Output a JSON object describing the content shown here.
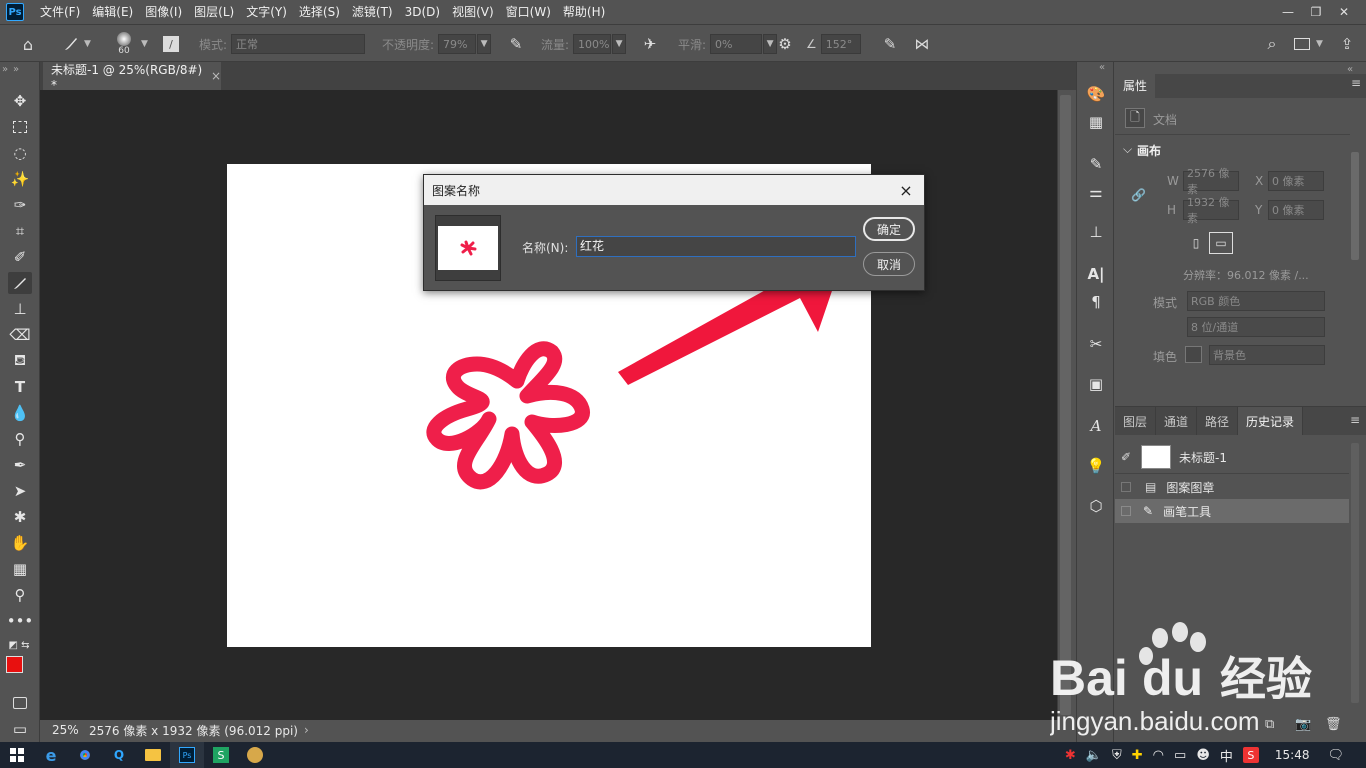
{
  "app": {
    "logo": "Ps"
  },
  "menu": [
    "文件(F)",
    "编辑(E)",
    "图像(I)",
    "图层(L)",
    "文字(Y)",
    "选择(S)",
    "滤镜(T)",
    "3D(D)",
    "视图(V)",
    "窗口(W)",
    "帮助(H)"
  ],
  "options": {
    "brush_size": "60",
    "mode_label": "模式:",
    "mode_value": "正常",
    "opacity_label": "不透明度:",
    "opacity_value": "79%",
    "flow_label": "流量:",
    "flow_value": "100%",
    "smooth_label": "平滑:",
    "smooth_value": "0%",
    "angle_value": "152°"
  },
  "document": {
    "tab_title": "未标题-1 @ 25%(RGB/8#) *",
    "tab_close": "×",
    "zoom": "25%",
    "size_info": "2576 像素 x 1932 像素 (96.012 ppi)",
    "status_arrow": "›"
  },
  "dialog": {
    "title": "图案名称",
    "close": "×",
    "name_label": "名称(N):",
    "name_value": "红花",
    "ok": "确定",
    "cancel": "取消"
  },
  "properties": {
    "tab": "属性",
    "doc_label": "文档",
    "section": "画布",
    "w_label": "W",
    "w_value": "2576 像素",
    "h_label": "H",
    "h_value": "1932 像素",
    "x_label": "X",
    "x_value": "0 像素",
    "y_label": "Y",
    "y_value": "0 像素",
    "resolution": "分辨率：96.012 像素 /...",
    "mode_label": "模式",
    "mode_value": "RGB 颜色",
    "depth_value": "8 位/通道",
    "fill_label": "填色",
    "fill_value": "背景色"
  },
  "layers_panel": {
    "tabs": [
      "图层",
      "通道",
      "路径",
      "历史记录"
    ],
    "snapshot": "未标题-1",
    "history": [
      "图案图章",
      "画笔工具"
    ]
  },
  "taskbar": {
    "ime": "中",
    "time": "15:48"
  },
  "watermark": {
    "brand": "Bai",
    "brand2": "du",
    "cn": "经验",
    "url": "jingyan.baidu.com"
  },
  "colors": {
    "foreground": "#e8100f",
    "background": "#ffffff",
    "flower": "#ef1f4a",
    "arrow": "#f0173c"
  }
}
